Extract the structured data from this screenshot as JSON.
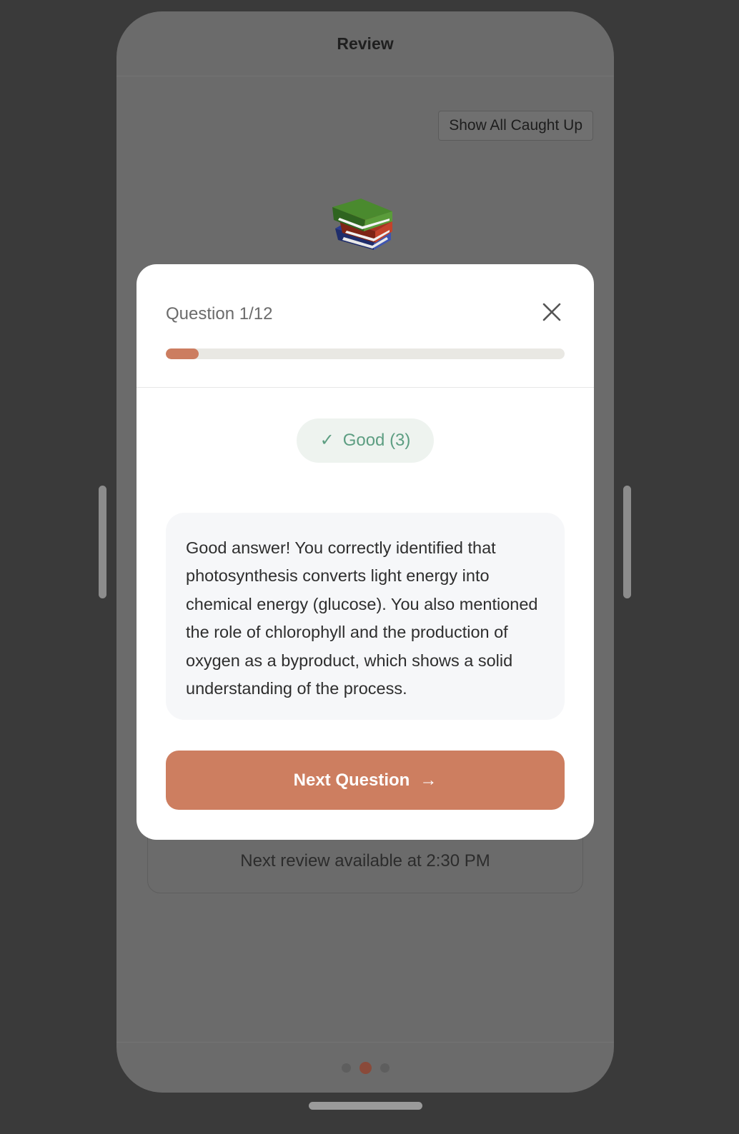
{
  "header": {
    "title": "Review"
  },
  "toolbar": {
    "show_all_label": "Show All Caught Up"
  },
  "status": {
    "next_review_text": "Next review available at 2:30 PM"
  },
  "pagination": {
    "total_pages": 3,
    "current_page": 2
  },
  "modal": {
    "question_label": "Question 1/12",
    "progress_fraction": 0.083,
    "grade_label": "Good (3)",
    "feedback": "Good answer! You correctly identified that photosynthesis converts light energy into chemical energy (glucose). You also mentioned the role of chlorophyll and the production of oxygen as a byproduct, which shows a solid understanding of the process.",
    "next_button_label": "Next Question",
    "icons": {
      "close": "close-icon",
      "check": "check-icon",
      "arrow": "arrow-right-icon"
    }
  },
  "colors": {
    "accent": "#cd7e60",
    "success": "#5d9e82",
    "success_bg": "#eef3ef"
  }
}
